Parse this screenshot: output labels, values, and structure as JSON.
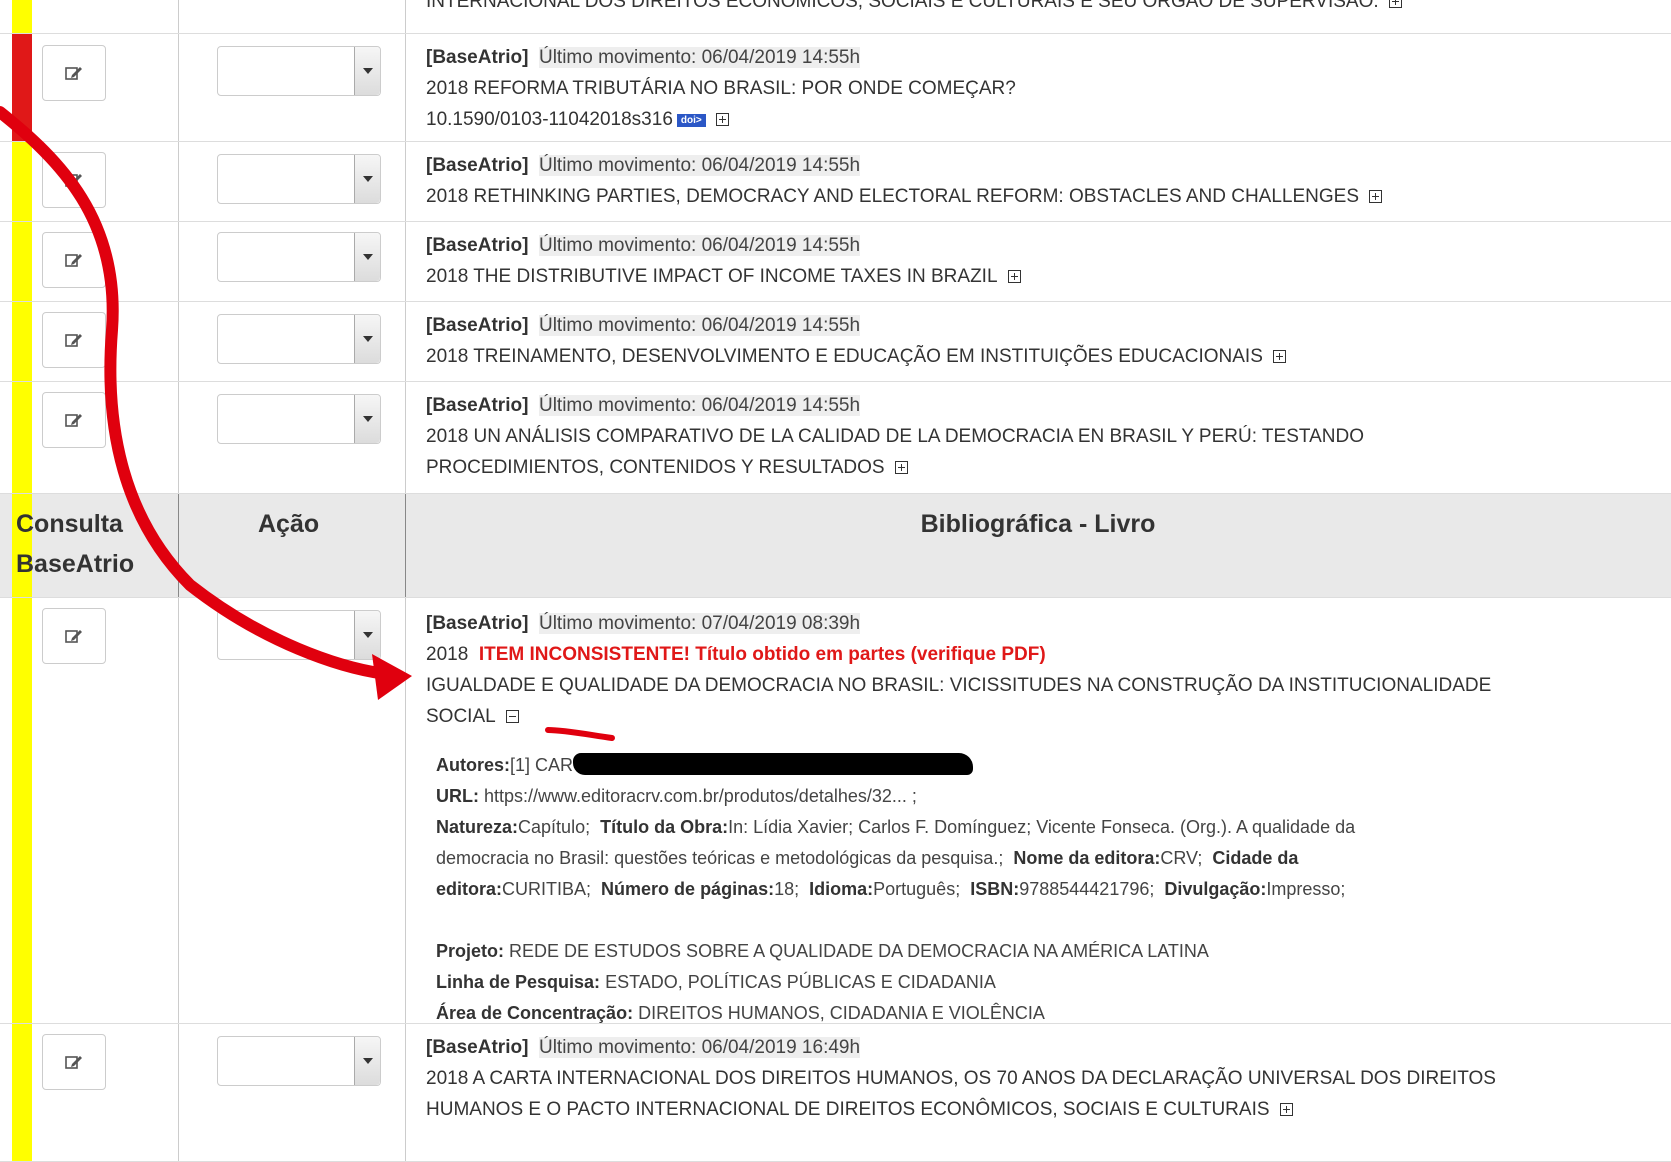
{
  "header": {
    "consulta": "Consulta BaseAtrio",
    "acao": "Ação",
    "secao": "Bibliográfica - Livro"
  },
  "row0": {
    "text": "INTERNACIONAL DOS DIREITOS ECONÔMICOS, SOCIAIS E CULTURAIS E SEU ÓRGÃO DE SUPERVISÃO."
  },
  "rows": [
    {
      "tag": "[BaseAtrio]",
      "mov": "Último movimento: 06/04/2019 14:55h",
      "title": "2018  REFORMA TRIBUTÁRIA NO BRASIL: POR ONDE COMEÇAR?",
      "doi": "10.1590/0103-11042018s316",
      "doi_badge": "doi>"
    },
    {
      "tag": "[BaseAtrio]",
      "mov": "Último movimento: 06/04/2019 14:55h",
      "title": "2018  RETHINKING PARTIES, DEMOCRACY AND ELECTORAL REFORM: OBSTACLES AND CHALLENGES"
    },
    {
      "tag": "[BaseAtrio]",
      "mov": "Último movimento: 06/04/2019 14:55h",
      "title": "2018  THE DISTRIBUTIVE IMPACT OF INCOME TAXES IN BRAZIL"
    },
    {
      "tag": "[BaseAtrio]",
      "mov": "Último movimento: 06/04/2019 14:55h",
      "title": "2018  TREINAMENTO, DESENVOLVIMENTO E EDUCAÇÃO EM INSTITUIÇÕES EDUCACIONAIS"
    },
    {
      "tag": "[BaseAtrio]",
      "mov": "Último movimento: 06/04/2019 14:55h",
      "title1": "2018  UN ANÁLISIS COMPARATIVO DE LA CALIDAD DE LA DEMOCRACIA EN BRASIL Y PERÚ: TESTANDO",
      "title2": "PROCEDIMIENTOS, CONTENIDOS Y RESULTADOS"
    }
  ],
  "book": {
    "tag": "[BaseAtrio]",
    "mov": "Último movimento: 07/04/2019 08:39h",
    "year": "2018",
    "warning": "ITEM INCONSISTENTE! Título obtido em partes (verifique PDF)",
    "title1": "IGUALDADE E QUALIDADE DA DEMOCRACIA NO BRASIL: VICISSITUDES NA CONSTRUÇÃO DA INSTITUCIONALIDADE",
    "title2": "SOCIAL",
    "autores_label": "Autores:",
    "autores_value": "[1] CAR",
    "url_label": "URL:",
    "url_value": "https://www.editoracrv.com.br/produtos/detalhes/32... ;",
    "natureza_label": "Natureza:",
    "natureza_value": "Capítulo;",
    "obra_label": "Título da Obra:",
    "obra_value1": "In: Lídia Xavier; Carlos F. Domínguez; Vicente Fonseca. (Org.). A qualidade da",
    "obra_value2": "democracia no Brasil: questões teóricas e metodológicas da pesquisa.;",
    "editora_label": "Nome da editora:",
    "editora_value": "CRV;",
    "cidade_label1": "Cidade da",
    "cidade_label2": "editora:",
    "cidade_value": "CURITIBA;",
    "paginas_label": "Número de páginas:",
    "paginas_value": "18;",
    "idioma_label": "Idioma:",
    "idioma_value": "Português;",
    "isbn_label": "ISBN:",
    "isbn_value": "9788544421796;",
    "divulgacao_label": "Divulgação:",
    "divulgacao_value": "Impresso;",
    "projeto_label": "Projeto:",
    "projeto_value": "REDE DE ESTUDOS SOBRE A QUALIDADE DA DEMOCRACIA NA AMÉRICA LATINA",
    "linha_label": "Linha de Pesquisa:",
    "linha_value": "ESTADO, POLÍTICAS PÚBLICAS E CIDADANIA",
    "area_label": "Área de Concentração:",
    "area_value": "DIREITOS HUMANOS, CIDADANIA E VIOLÊNCIA"
  },
  "last": {
    "tag": "[BaseAtrio]",
    "mov": "Último movimento: 06/04/2019 16:49h",
    "title1": "2018  A CARTA INTERNACIONAL DOS DIREITOS HUMANOS, OS 70 ANOS DA DECLARAÇÃO UNIVERSAL DOS DIREITOS",
    "title2": "HUMANOS E O PACTO INTERNACIONAL DE DIREITOS ECONÔMICOS, SOCIAIS E CULTURAIS"
  },
  "colors": {
    "status_red": "#e01818",
    "status_yellow": "#ffff00",
    "doi_blue": "#2b57c6",
    "annotation_arrow": "#e0000e"
  },
  "icons": {
    "edit": "edit-icon",
    "select_arrow": "dropdown-arrow-icon",
    "expand": "expand-plus-icon",
    "collapse": "collapse-minus-icon"
  }
}
